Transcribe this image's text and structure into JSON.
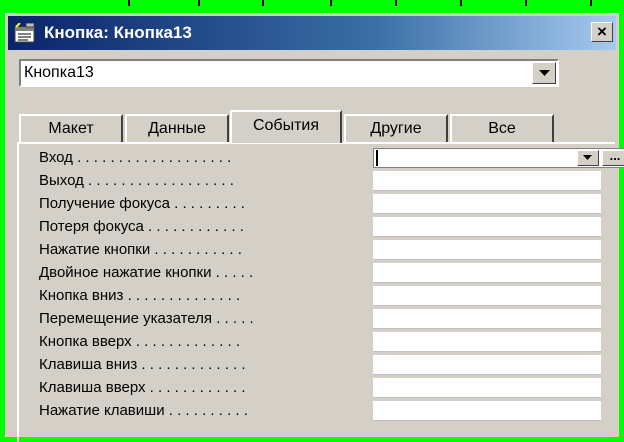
{
  "window": {
    "title": "Кнопка: Кнопка13",
    "close_glyph": "×"
  },
  "object_selector": {
    "value": "Кнопка13"
  },
  "tabs": [
    {
      "label": "Макет",
      "active": false
    },
    {
      "label": "Данные",
      "active": false
    },
    {
      "label": "События",
      "active": true
    },
    {
      "label": "Другие",
      "active": false
    },
    {
      "label": "Все",
      "active": false
    }
  ],
  "properties": [
    {
      "label": "Вход . . . . . . . . . . . . . . . . . . .",
      "value": ""
    },
    {
      "label": "Выход . . . . . . . . . . . . . . . . . .",
      "value": ""
    },
    {
      "label": "Получение фокуса . . . . . . . . .",
      "value": ""
    },
    {
      "label": "Потеря фокуса . . . . . . . . . . . .",
      "value": ""
    },
    {
      "label": "Нажатие кнопки . . . . . . . . . . .",
      "value": ""
    },
    {
      "label": "Двойное нажатие кнопки . . . . .",
      "value": ""
    },
    {
      "label": "Кнопка вниз . . . . . . . . . . . . . .",
      "value": ""
    },
    {
      "label": "Перемещение указателя . . . . .",
      "value": ""
    },
    {
      "label": "Кнопка вверх . . . . . . . . . . . . .",
      "value": ""
    },
    {
      "label": "Клавиша вниз . . . . . . . . . . . . .",
      "value": ""
    },
    {
      "label": "Клавиша вверх . . . . . . . . . . . .",
      "value": ""
    },
    {
      "label": "Нажатие клавиши . . . . . . . . . .",
      "value": ""
    }
  ],
  "builder_glyph": "...",
  "colors": {
    "background": "#00ff00",
    "window_face": "#d4d0c8",
    "titlebar_start": "#0a246a",
    "titlebar_end": "#a6caf0"
  },
  "icons": {
    "window": "property-sheet-icon",
    "close": "close-icon",
    "dropdown": "dropdown-arrow-icon",
    "builder": "builder-ellipsis-icon"
  }
}
